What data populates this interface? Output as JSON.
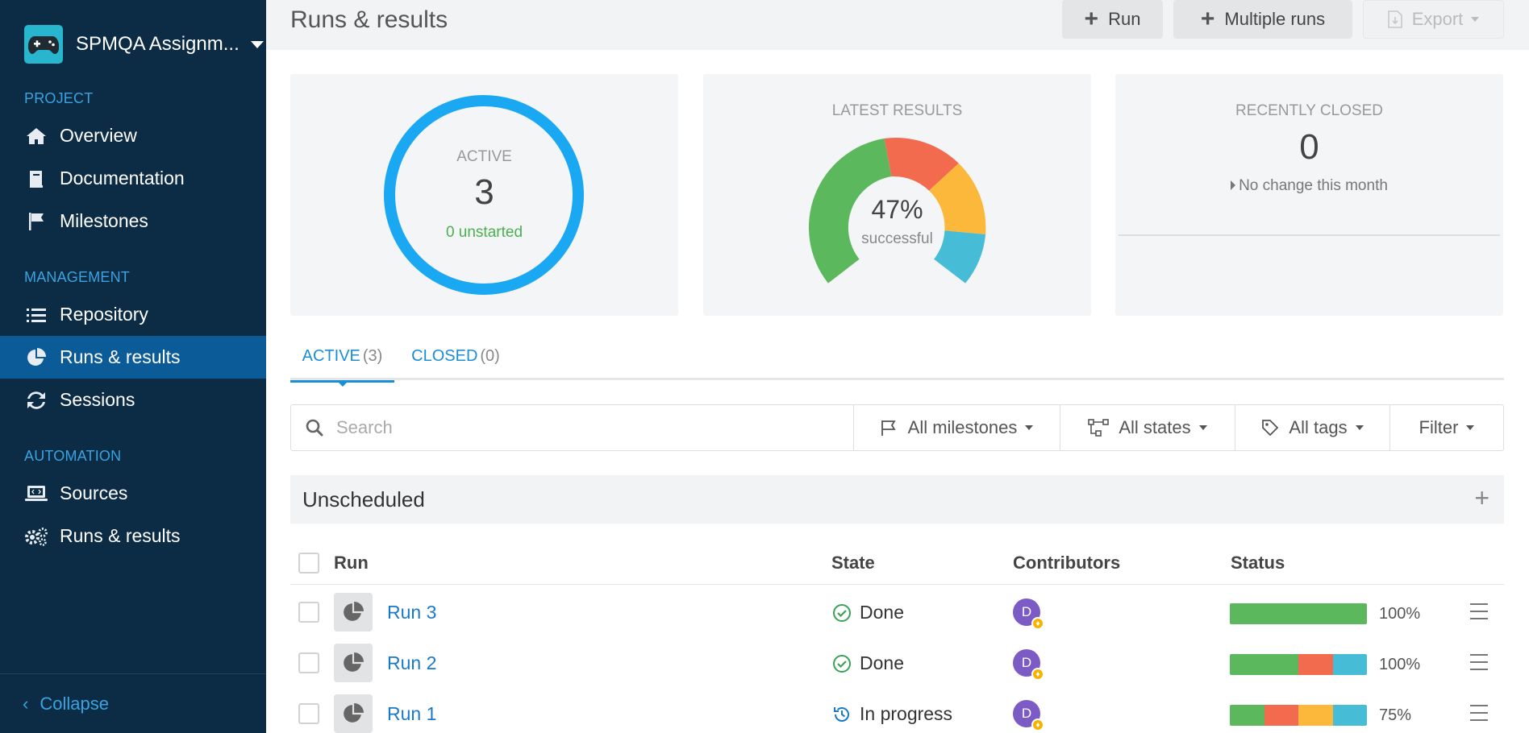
{
  "sidebar": {
    "project_name": "SPMQA Assignm...",
    "sections": {
      "project": "PROJECT",
      "management": "MANAGEMENT",
      "automation": "AUTOMATION"
    },
    "items": {
      "overview": "Overview",
      "documentation": "Documentation",
      "milestones": "Milestones",
      "repository": "Repository",
      "runs_results": "Runs & results",
      "sessions": "Sessions",
      "sources": "Sources",
      "auto_runs_results": "Runs & results"
    },
    "collapse": "Collapse"
  },
  "header": {
    "title": "Runs & results",
    "run_btn": "Run",
    "multiple_runs_btn": "Multiple runs",
    "export_btn": "Export"
  },
  "cards": {
    "active": {
      "label": "ACTIVE",
      "value": "3",
      "sub": "0 unstarted"
    },
    "latest": {
      "label": "LATEST RESULTS",
      "value": "47%",
      "sub": "successful"
    },
    "closed": {
      "label": "RECENTLY CLOSED",
      "value": "0",
      "sub": "No change this month"
    }
  },
  "tabs": {
    "active": {
      "label": "ACTIVE",
      "count": "(3)"
    },
    "closed": {
      "label": "CLOSED",
      "count": "(0)"
    }
  },
  "filters": {
    "search_placeholder": "Search",
    "milestones": "All milestones",
    "states": "All states",
    "tags": "All tags",
    "filter": "Filter"
  },
  "group": {
    "title": "Unscheduled"
  },
  "table": {
    "headers": {
      "run": "Run",
      "state": "State",
      "contributors": "Contributors",
      "status": "Status"
    },
    "rows": [
      {
        "name": "Run 3",
        "state": "Done",
        "contributor": "D",
        "pct": "100%"
      },
      {
        "name": "Run 2",
        "state": "Done",
        "contributor": "D",
        "pct": "100%"
      },
      {
        "name": "Run 1",
        "state": "In progress",
        "contributor": "D",
        "pct": "75%"
      }
    ]
  },
  "colors": {
    "passed": "#5cb85c",
    "failed": "#f26b4f",
    "blocked": "#fcb83a",
    "retest": "#46bcd6",
    "accent": "#1a8fd6",
    "sidebar": "#0c2b45"
  }
}
